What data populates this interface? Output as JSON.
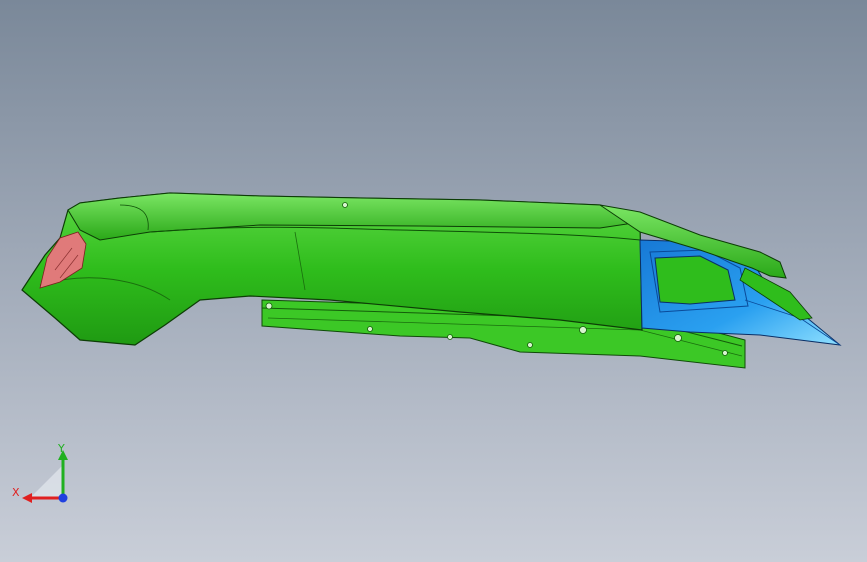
{
  "triad": {
    "x_label": "X",
    "y_label": "Y",
    "colors": {
      "x": "#e02020",
      "y": "#20b020",
      "z": "#2040e0"
    }
  },
  "model": {
    "colors": {
      "body": "#2fbd1c",
      "body_dark": "#1c8a10",
      "body_light": "#6de052",
      "inner": "#1e8fe6",
      "inner_light": "#7cd2ff",
      "accent_red": "#e07a7a"
    }
  }
}
